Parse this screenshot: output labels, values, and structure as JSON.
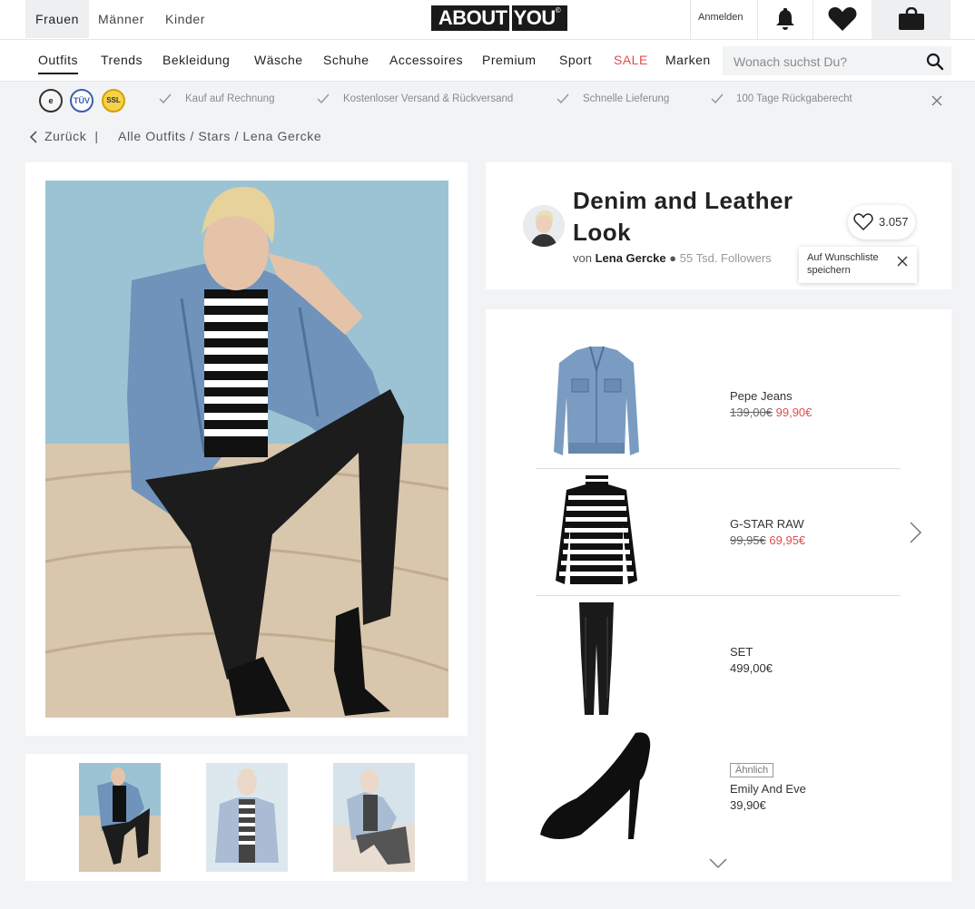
{
  "header": {
    "genders": [
      "Frauen",
      "Männer",
      "Kinder"
    ],
    "logo_left": "ABOUT",
    "logo_right": "YOU",
    "login_label": "Anmelden"
  },
  "nav": {
    "items": [
      "Outfits",
      "Trends",
      "Bekleidung",
      "Wäsche",
      "Schuhe",
      "Accessoires",
      "Premium",
      "Sport",
      "SALE",
      "Marken"
    ],
    "search_placeholder": "Wonach suchst Du?"
  },
  "trust": {
    "usps": [
      "Kauf auf Rechnung",
      "Kostenloser Versand & Rückversand",
      "Schnelle Lieferung",
      "100 Tage Rückgaberecht"
    ]
  },
  "breadcrumb": {
    "back_label": "Zurück",
    "separator": "|",
    "path": "Alle Outfits / Stars / Lena Gercke"
  },
  "look": {
    "title": "Denim and Leather Look",
    "by_prefix": "von",
    "author": "Lena Gercke",
    "bullet": "●",
    "followers": "55 Tsd. Followers",
    "likes": "3.057",
    "wishlist_tooltip": "Auf Wunschliste speichern"
  },
  "products": [
    {
      "brand": "Pepe Jeans",
      "old_price": "139,00€",
      "price": "99,90€"
    },
    {
      "brand": "G-STAR RAW",
      "old_price": "99,95€",
      "price": "69,95€"
    },
    {
      "brand": "SET",
      "old_price": "",
      "price": "499,00€"
    },
    {
      "brand": "Emily And Eve",
      "old_price": "",
      "price": "39,90€",
      "badge": "Ähnlich"
    }
  ],
  "colors": {
    "sale": "#e34c4c",
    "accent": "#1a1a1a"
  }
}
